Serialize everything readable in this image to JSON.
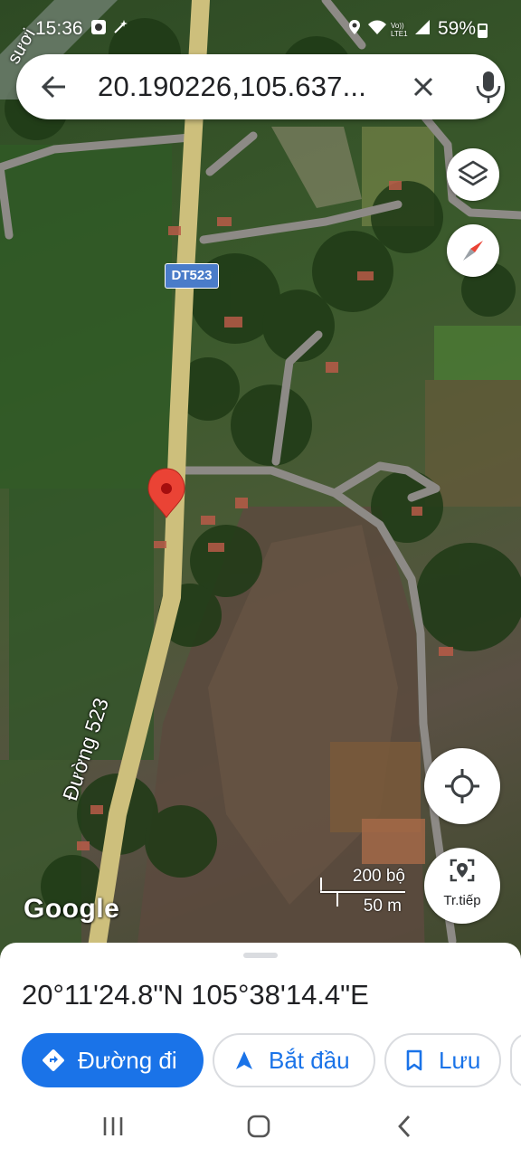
{
  "status_bar": {
    "time": "15:36",
    "battery": "59%",
    "network_label": "Vo)) LTE1"
  },
  "search": {
    "query": "20.190226,105.637..."
  },
  "map": {
    "road_shield": "DT523",
    "road_name": "Đường 523",
    "village_label": "sươi",
    "google_logo": "Google",
    "scale_imperial": "200 bộ",
    "scale_metric": "50 m",
    "live_view_label": "Tr.tiếp",
    "pin_color": "#ea4335"
  },
  "place": {
    "coordinates": "20°11'24.8\"N 105°38'14.4\"E"
  },
  "actions": {
    "directions": "Đường đi",
    "start": "Bắt đầu",
    "save": "Lưu"
  },
  "colors": {
    "accent": "#1a73e8",
    "text": "#202124"
  },
  "icons": {
    "back": "arrow-left",
    "close": "x",
    "mic": "microphone",
    "layers": "layers",
    "compass": "compass-needle",
    "locate": "crosshair",
    "live": "location-scan",
    "directions": "diamond-arrow",
    "start": "navigation-triangle",
    "save": "bookmark"
  }
}
